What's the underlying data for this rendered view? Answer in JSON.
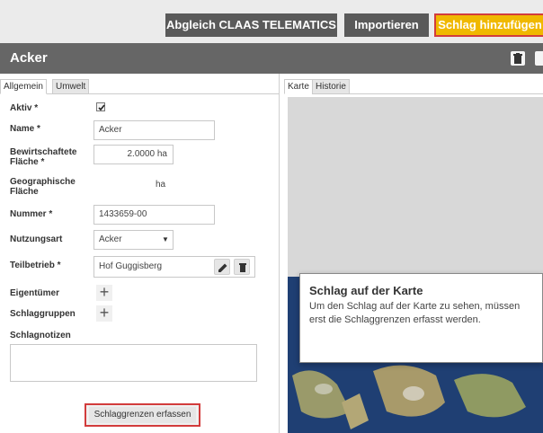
{
  "toolbar": {
    "claas_label": "Abgleich CLAAS TELEMATICS",
    "import_label": "Importieren",
    "add_label": "Schlag hinzufügen"
  },
  "header": {
    "title": "Acker"
  },
  "left_tabs": [
    "Allgemein",
    "Umwelt"
  ],
  "right_tabs": [
    "Karte",
    "Historie"
  ],
  "form": {
    "aktiv_label": "Aktiv *",
    "aktiv_checked": true,
    "name_label": "Name *",
    "name_value": "Acker",
    "area_label_1": "Bewirtschaftete",
    "area_label_2": "Fläche *",
    "area_value": "2.0000 ha",
    "geo_label_1": "Geographische",
    "geo_label_2": "Fläche",
    "geo_value": "ha",
    "number_label": "Nummer *",
    "number_value": "1433659-00",
    "usage_label": "Nutzungsart",
    "usage_value": "Acker",
    "sub_label": "Teilbetrieb *",
    "sub_value": "Hof Guggisberg",
    "owner_label": "Eigentümer",
    "groups_label": "Schlaggruppen",
    "notes_label": "Schlagnotizen",
    "capture_button": "Schlaggrenzen erfassen"
  },
  "map_popup": {
    "title": "Schlag auf der Karte",
    "text": "Um den Schlag auf der Karte zu sehen, müssen erst die Schlaggrenzen erfasst werden."
  },
  "colors": {
    "accent": "#f0b800",
    "dark": "#666666",
    "highlight_border": "#d23c3c"
  }
}
